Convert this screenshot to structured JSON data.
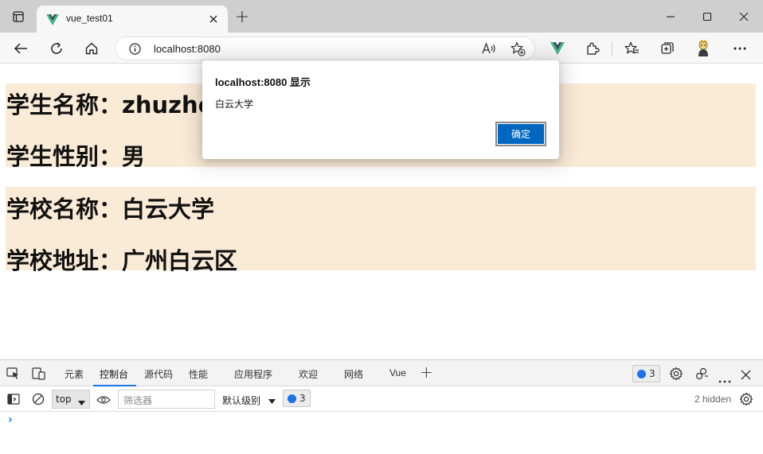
{
  "browser": {
    "tab_title": "vue_test01",
    "new_tab_label": "+",
    "url": "localhost:8080"
  },
  "page": {
    "student_name": "学生名称：zhuzhe",
    "student_gender": "学生性别：男",
    "school_name": "学校名称：白云大学",
    "school_address": "学校地址：广州白云区",
    "band_color": "#faebd7"
  },
  "dialog": {
    "title": "localhost:8080 显示",
    "message": "白云大学",
    "ok_label": "确定",
    "ok_color": "#0067c0"
  },
  "devtools": {
    "tabs": [
      "元素",
      "控制台",
      "源代码",
      "性能",
      "应用程序",
      "欢迎",
      "网络",
      "Vue"
    ],
    "active_tab": "控制台",
    "add_tab": "+",
    "issues_count": "3",
    "context": "top",
    "filter_placeholder": "筛选器",
    "log_level": "默认级别",
    "messages_count": "3",
    "hidden_label": "2 hidden",
    "prompt": "›"
  }
}
